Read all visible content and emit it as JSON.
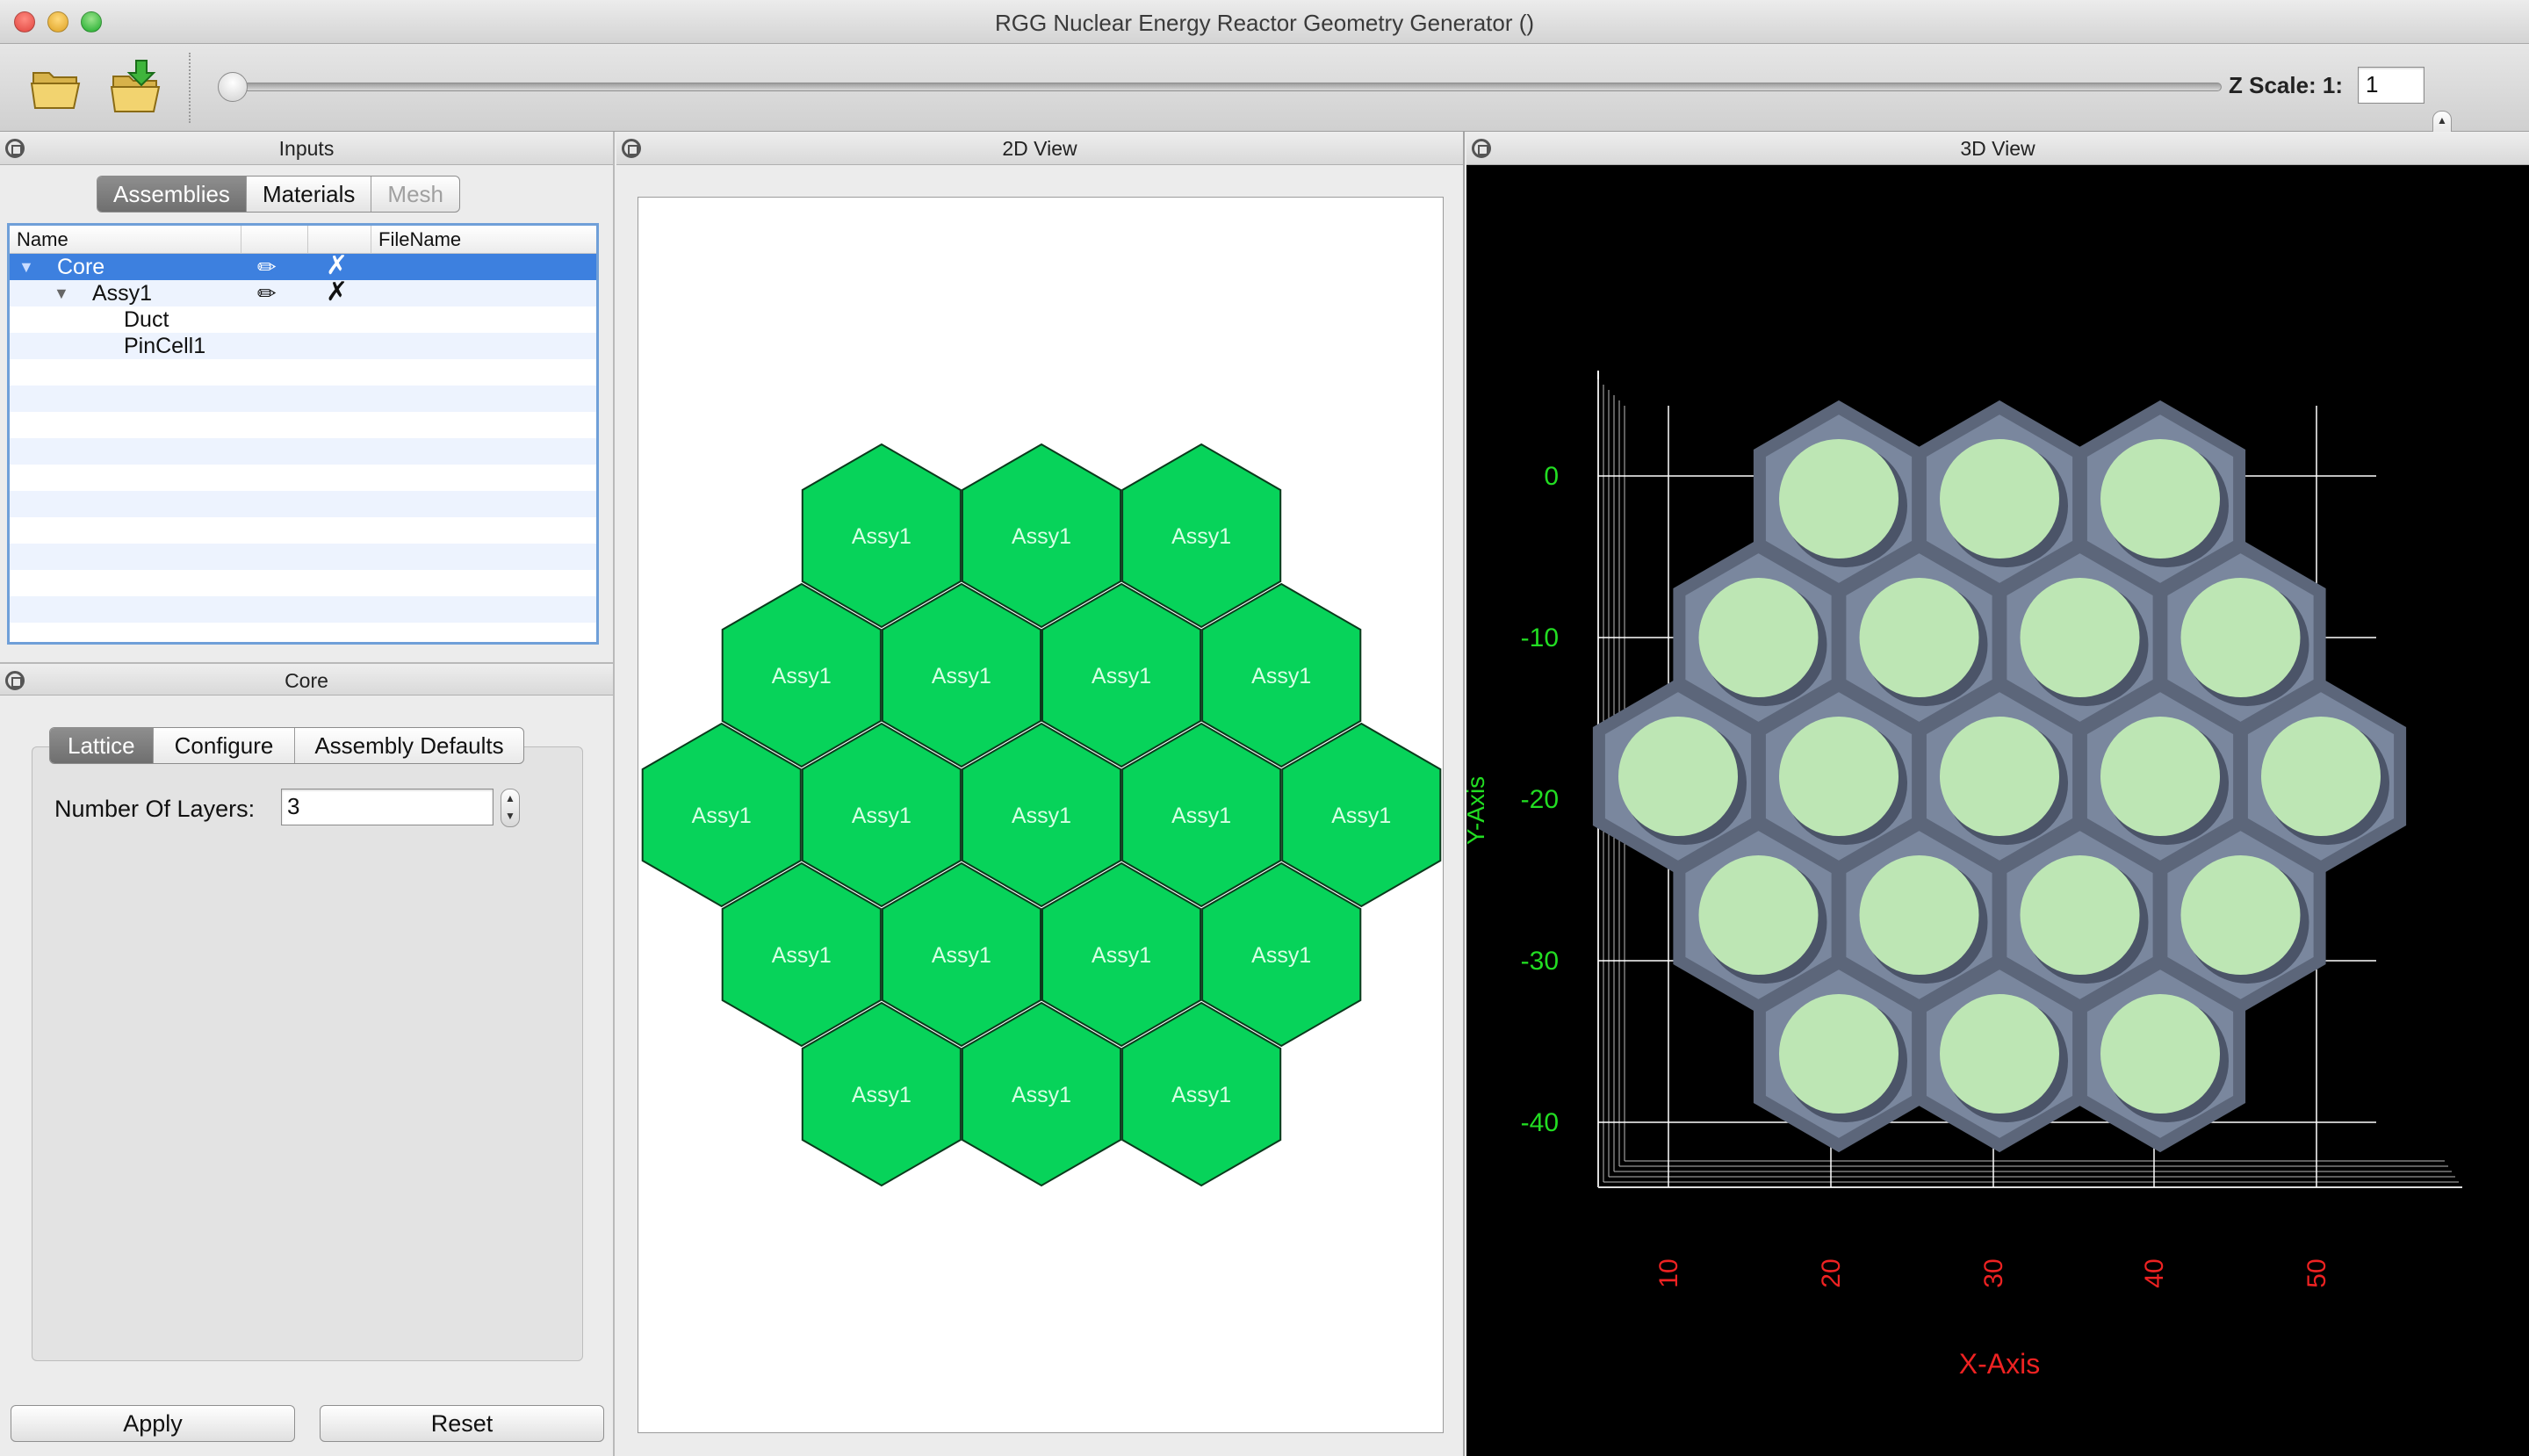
{
  "window": {
    "title": "RGG Nuclear Energy Reactor Geometry Generator ()"
  },
  "toolbar": {
    "open_icon": "folder-open-icon",
    "import_icon": "folder-import-icon",
    "zscale_label": "Z Scale: 1:",
    "zscale_value": "1"
  },
  "inputs_panel": {
    "title": "Inputs",
    "tabs": [
      {
        "label": "Assemblies",
        "state": "active"
      },
      {
        "label": "Materials",
        "state": "normal"
      },
      {
        "label": "Mesh",
        "state": "disabled"
      }
    ],
    "tree": {
      "columns": [
        "Name",
        "",
        "",
        "FileName"
      ],
      "rows": [
        {
          "label": "Core",
          "depth": 0,
          "expanded": true,
          "editable": true,
          "deletable": true,
          "selected": true
        },
        {
          "label": "Assy1",
          "depth": 1,
          "expanded": true,
          "editable": true,
          "deletable": true,
          "selected": false
        },
        {
          "label": "Duct",
          "depth": 2,
          "editable": false,
          "deletable": false,
          "selected": false
        },
        {
          "label": "PinCell1",
          "depth": 2,
          "editable": false,
          "deletable": false,
          "selected": false
        }
      ],
      "edit_glyph": "✏",
      "delete_glyph": "✗"
    }
  },
  "core_panel": {
    "title": "Core",
    "tabs": [
      {
        "label": "Lattice",
        "state": "active"
      },
      {
        "label": "Configure",
        "state": "normal"
      },
      {
        "label": "Assembly Defaults",
        "state": "normal"
      }
    ],
    "layers_label": "Number Of Layers:",
    "layers_value": "3",
    "apply_label": "Apply",
    "reset_label": "Reset"
  },
  "view2d": {
    "title": "2D View",
    "cell_label": "Assy1",
    "rows": [
      3,
      4,
      5,
      4,
      3
    ],
    "fill_color": "#07d35a",
    "stroke_color": "#0b3a1c",
    "label_color": "#d8ffe4"
  },
  "view3d": {
    "title": "3D View",
    "y_axis_label": "Y-Axis",
    "x_axis_label": "X-Axis",
    "y_ticks": [
      "0",
      "-10",
      "-20",
      "-30",
      "-40"
    ],
    "x_ticks": [
      "10",
      "20",
      "30",
      "40",
      "50"
    ],
    "y_tick_color": "#22dd22",
    "x_tick_color": "#ee2222",
    "hex_color": "#7a879e",
    "hex_border": "#5c667a",
    "pin_color": "#bde6b4",
    "rows": [
      3,
      4,
      5,
      4,
      3
    ]
  }
}
